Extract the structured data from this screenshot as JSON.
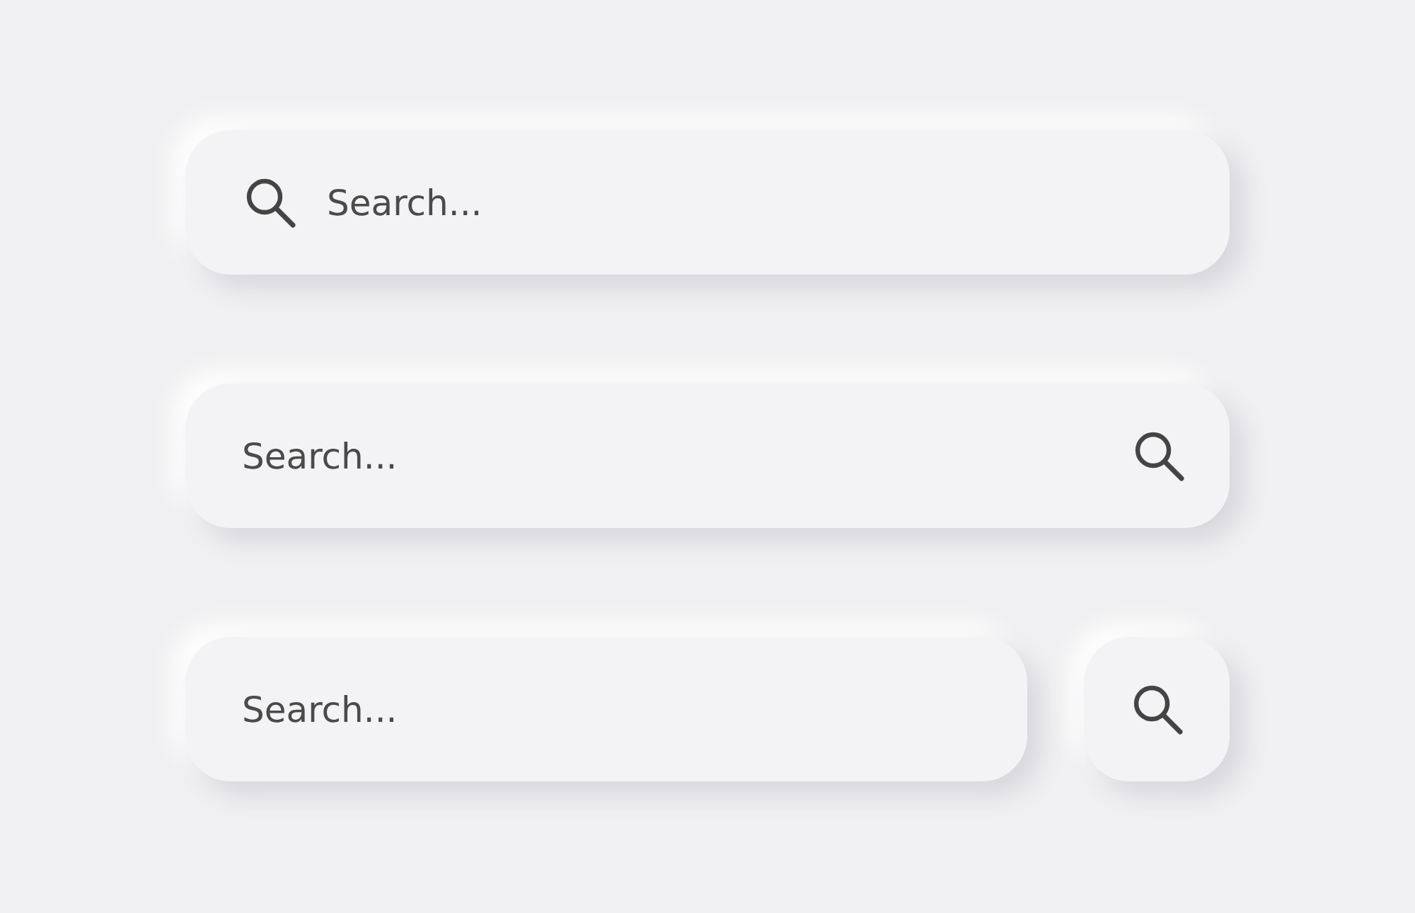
{
  "search_bars": [
    {
      "kind": "icon-left",
      "placeholder": "Search..."
    },
    {
      "kind": "icon-right",
      "placeholder": "Search..."
    },
    {
      "kind": "button",
      "placeholder": "Search..."
    }
  ]
}
